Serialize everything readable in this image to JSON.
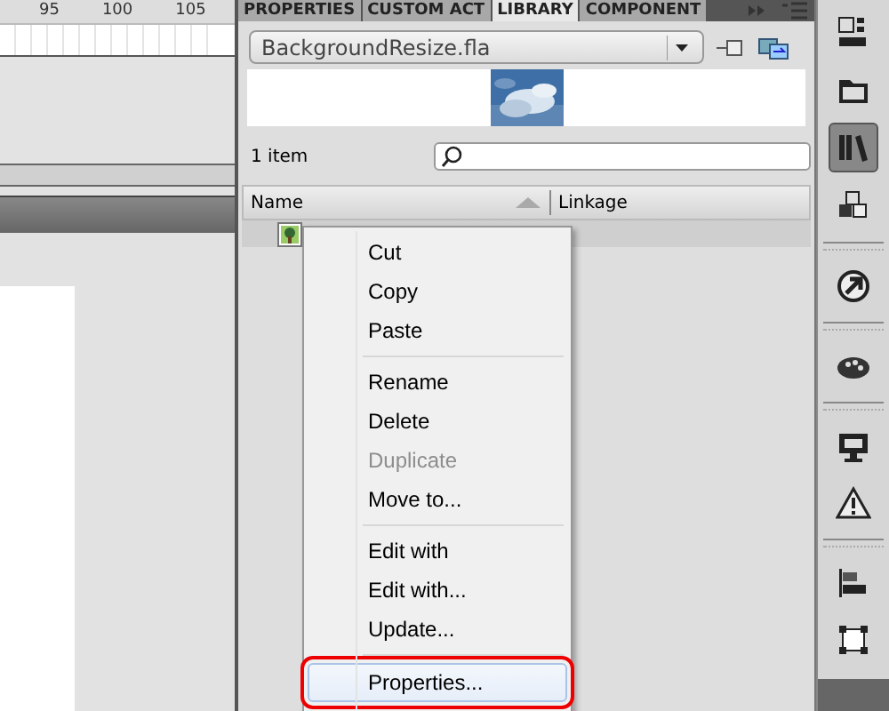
{
  "timeline": {
    "ruler": [
      "95",
      "100",
      "105"
    ]
  },
  "panel_tabs": [
    {
      "label": "PROPERTIES",
      "selected": false
    },
    {
      "label": "CUSTOM ACT",
      "selected": false
    },
    {
      "label": "LIBRARY",
      "selected": true
    },
    {
      "label": "COMPONENT",
      "selected": false
    }
  ],
  "library": {
    "document": "BackgroundResize.fla",
    "item_count": "1 item",
    "columns": [
      "Name",
      "Linkage"
    ]
  },
  "context_menu": [
    {
      "kind": "item",
      "label": "Cut",
      "disabled": false,
      "selected": false
    },
    {
      "kind": "item",
      "label": "Copy",
      "disabled": false,
      "selected": false
    },
    {
      "kind": "item",
      "label": "Paste",
      "disabled": false,
      "selected": false
    },
    {
      "kind": "separator"
    },
    {
      "kind": "item",
      "label": "Rename",
      "disabled": false,
      "selected": false
    },
    {
      "kind": "item",
      "label": "Delete",
      "disabled": false,
      "selected": false
    },
    {
      "kind": "item",
      "label": "Duplicate",
      "disabled": true,
      "selected": false
    },
    {
      "kind": "item",
      "label": "Move to...",
      "disabled": false,
      "selected": false
    },
    {
      "kind": "separator"
    },
    {
      "kind": "item",
      "label": "Edit with",
      "disabled": false,
      "selected": false
    },
    {
      "kind": "item",
      "label": "Edit with...",
      "disabled": false,
      "selected": false
    },
    {
      "kind": "item",
      "label": "Update...",
      "disabled": false,
      "selected": false
    },
    {
      "kind": "separator"
    },
    {
      "kind": "item",
      "label": "Properties...",
      "disabled": false,
      "selected": true
    }
  ],
  "dock": [
    {
      "kind": "info",
      "selected": false
    },
    {
      "kind": "folder",
      "selected": false
    },
    {
      "kind": "books",
      "selected": true
    },
    {
      "kind": "cubes",
      "selected": false
    },
    {
      "kind": "group"
    },
    {
      "kind": "arrow",
      "selected": false
    },
    {
      "kind": "group"
    },
    {
      "kind": "palette",
      "selected": false
    },
    {
      "kind": "group"
    },
    {
      "kind": "monitor",
      "selected": false
    },
    {
      "kind": "warning",
      "selected": false
    },
    {
      "kind": "group"
    },
    {
      "kind": "align",
      "selected": false
    },
    {
      "kind": "transform",
      "selected": false
    }
  ]
}
